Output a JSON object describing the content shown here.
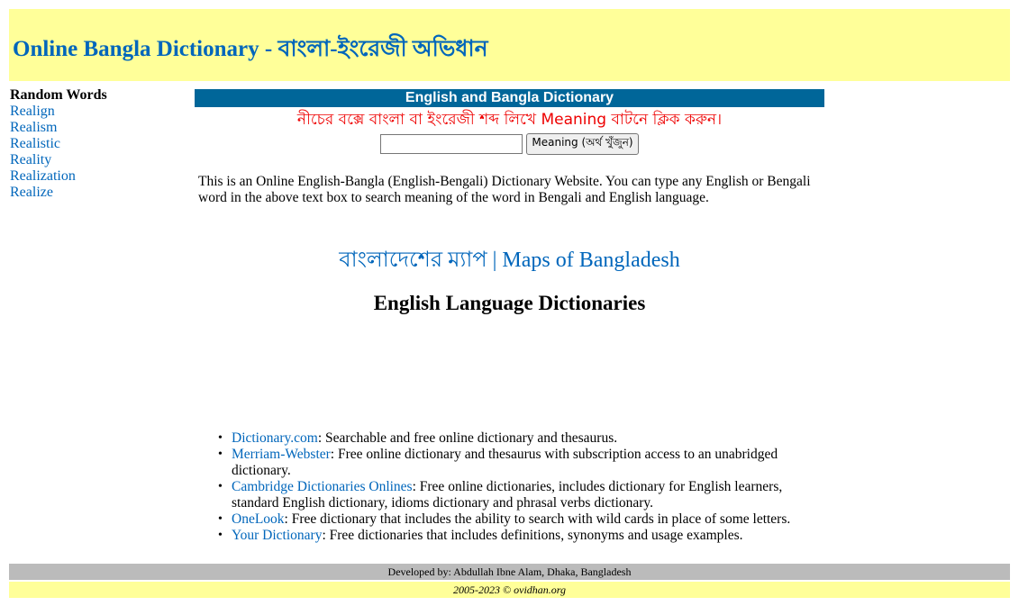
{
  "header": {
    "title": "Online Bangla Dictionary - বাংলা-ইংরেজী অভিধান"
  },
  "sidebar": {
    "heading": "Random Words",
    "words": [
      "Realign",
      "Realism",
      "Realistic",
      "Reality",
      "Realization",
      "Realize"
    ]
  },
  "dictionary_bar": {
    "title": "English and Bangla Dictionary"
  },
  "search": {
    "instruction": "নীচের বক্সে বাংলা বা ইংরেজী শব্দ লিখে Meaning বাটনে ক্লিক করুন।",
    "input_value": "",
    "button_label": "Meaning (অর্থ খুঁজুন)"
  },
  "intro": {
    "text": "This is an Online English-Bangla (English-Bengali) Dictionary Website. You can type any English or Bengali word in the above text box to search meaning of the word in Bengali and English language."
  },
  "maps": {
    "bangla_label": "বাংলাদেশের ম্যাপ",
    "separator": "|",
    "english_label": "Maps of Bangladesh"
  },
  "english_dictionaries": {
    "title": "English Language Dictionaries",
    "items": [
      {
        "name": "Dictionary.com",
        "description": ": Searchable and free online dictionary and thesaurus."
      },
      {
        "name": "Merriam-Webster",
        "description": ": Free online dictionary and thesaurus with subscription access to an unabridged dictionary."
      },
      {
        "name": "Cambridge Dictionaries Onlines",
        "description": ": Free online dictionaries, includes dictionary for English learners, standard English dictionary, idioms dictionary and phrasal verbs dictionary."
      },
      {
        "name": "OneLook",
        "description": ": Free dictionary that includes the ability to search with wild cards in place of some letters."
      },
      {
        "name": "Your Dictionary",
        "description": ": Free dictionaries that includes definitions, synonyms and usage examples."
      }
    ],
    "bullet": "•"
  },
  "footer": {
    "developed_by": "Developed by: Abdullah Ibne Alam, Dhaka, Bangladesh",
    "copyright": "2005-2023 © ovidhan.org"
  },
  "colors": {
    "header_bg": "#ffff99",
    "link": "#0066bb",
    "dict_bar_bg": "#006699",
    "instruction": "#ee0000",
    "footer_dev_bg": "#bbbbbb"
  }
}
